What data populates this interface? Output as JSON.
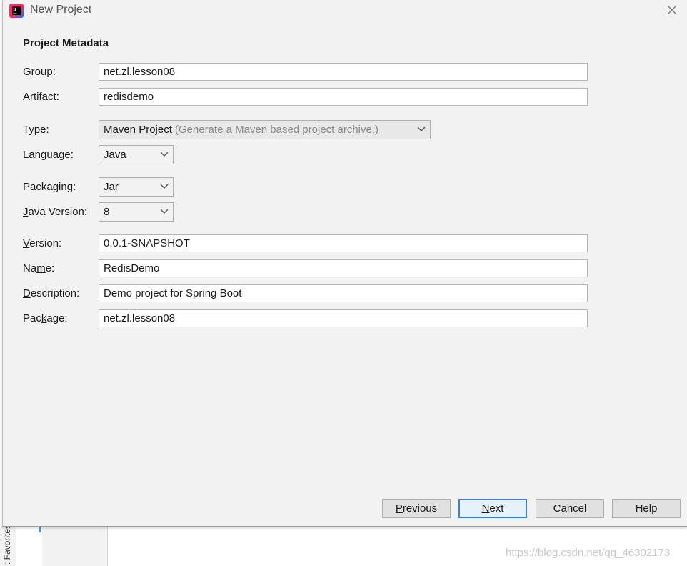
{
  "window": {
    "title": "New Project"
  },
  "section_title": "Project Metadata",
  "fields": {
    "group": {
      "label": "Group:",
      "mnemonic": "G",
      "rest": "roup:",
      "value": "net.zl.lesson08"
    },
    "artifact": {
      "label": "Artifact:",
      "mnemonic": "A",
      "rest": "rtifact:",
      "value": "redisdemo"
    },
    "type": {
      "label": "Type:",
      "mnemonic": "T",
      "rest": "ype:",
      "value": "Maven Project",
      "hint": "(Generate a Maven based project archive.)"
    },
    "language": {
      "label": "Language:",
      "pre": "",
      "mnemonic": "L",
      "rest": "anguage:",
      "value": "Java"
    },
    "packaging": {
      "label": "Packaging:",
      "pre": "Packa",
      "mnemonic": "g",
      "rest": "ing:",
      "value": "Jar"
    },
    "java_version": {
      "label": "Java Version:",
      "mnemonic": "J",
      "rest": "ava Version:",
      "value": "8"
    },
    "version": {
      "label": "Version:",
      "mnemonic": "V",
      "rest": "ersion:",
      "value": "0.0.1-SNAPSHOT"
    },
    "name": {
      "label": "Name:",
      "pre": "Na",
      "mnemonic": "m",
      "rest": "e:",
      "value": "RedisDemo"
    },
    "description": {
      "label": "Description:",
      "mnemonic": "D",
      "rest": "escription:",
      "value": "Demo project for Spring Boot"
    },
    "package": {
      "label": "Package:",
      "pre": "Pac",
      "mnemonic": "k",
      "rest": "age:",
      "value": "net.zl.lesson08"
    }
  },
  "buttons": {
    "previous": {
      "mnemonic": "P",
      "rest": "revious"
    },
    "next": {
      "mnemonic": "N",
      "rest": "ext"
    },
    "cancel": "Cancel",
    "help": "Help"
  },
  "background": {
    "side_tab_label": ": Favorites",
    "watermark": "https://blog.csdn.net/qq_46302173"
  },
  "colors": {
    "dialog_bg": "#f2f2f2",
    "field_border": "#b4b4b4",
    "default_button_border": "#3c7fd1",
    "hint_text": "#8a8a8a"
  },
  "icons": {
    "app": "intellij-idea-icon",
    "close": "close-icon",
    "dropdown": "chevron-down-icon"
  }
}
